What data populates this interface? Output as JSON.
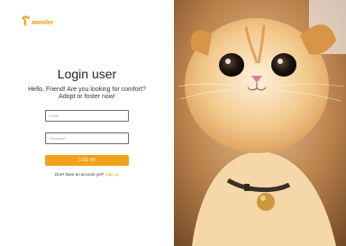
{
  "brand": {
    "name": "awnder",
    "logo_icon": "paw-icon",
    "accent_color": "#f0a21a"
  },
  "login": {
    "title": "Login user",
    "subtitle_line1": "Hello, Friend! Are you looking for comfort?",
    "subtitle_line2": "Adopt or foster now!",
    "email_placeholder": "Email",
    "password_placeholder": "Password",
    "button_label": "LOG IN",
    "no_account_text": "Don't have an account yet?",
    "signup_link": "Sign up"
  },
  "hero_image": {
    "subject": "cat-photo"
  }
}
